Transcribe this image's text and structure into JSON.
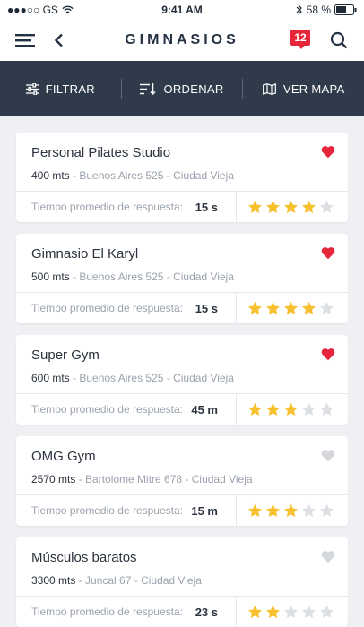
{
  "status": {
    "carrier": "●●●○○ GS",
    "time": "9:41 AM",
    "battery": "58 %"
  },
  "nav": {
    "title": "GIMNASIOS",
    "badge_count": "12"
  },
  "toolbar": {
    "filter": "FILTRAR",
    "sort": "ORDENAR",
    "map": "VER MAPA"
  },
  "colors": {
    "accent": "#e8263b",
    "toolbar_bg": "#2f3a4b",
    "star_on": "#f6c02e",
    "star_off": "#dcdfe3",
    "heart_off": "#d4d7db"
  },
  "gyms": [
    {
      "name": "Personal Pilates Studio",
      "distance": "400 mts",
      "address": "- Buenos Aires 525 - Ciudad Vieja",
      "response_label": "Tiempo promedio de respuesta:",
      "response": "15 s",
      "rating": 4,
      "favorite": true
    },
    {
      "name": "Gimnasio El Karyl",
      "distance": "500 mts",
      "address": "- Buenos Aires 525 - Ciudad Vieja",
      "response_label": "Tiempo promedio de respuesta:",
      "response": "15 s",
      "rating": 4,
      "favorite": true
    },
    {
      "name": "Super Gym",
      "distance": "600 mts",
      "address": "- Buenos Aires 525 - Ciudad Vieja",
      "response_label": "Tiempo promedio de respuesta:",
      "response": "45 m",
      "rating": 3,
      "favorite": true
    },
    {
      "name": "OMG Gym",
      "distance": "2570 mts",
      "address": "- Bartolome Mitre 678 - Ciudad Vieja",
      "response_label": "Tiempo promedio de respuesta:",
      "response": "15 m",
      "rating": 3,
      "favorite": false
    },
    {
      "name": "Músculos baratos",
      "distance": "3300 mts",
      "address": "- Juncal 67 - Ciudad Vieja",
      "response_label": "Tiempo promedio de respuesta:",
      "response": "23 s",
      "rating": 2,
      "favorite": false
    }
  ]
}
